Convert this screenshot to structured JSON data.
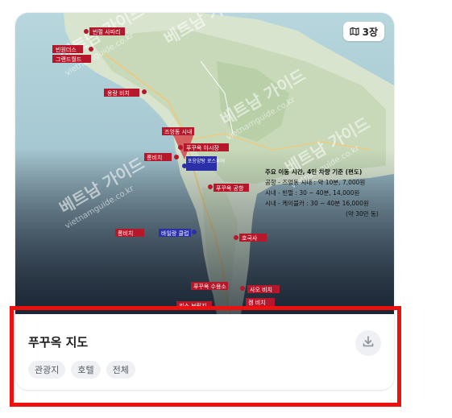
{
  "card": {
    "photo_count": "3장",
    "title": "푸꾸옥 지도",
    "tags": [
      "관광지",
      "호텔",
      "전체"
    ],
    "download_icon": "download-icon",
    "map_icon": "map-icon"
  },
  "map": {
    "watermark": [
      "베트남 가이드",
      "vietnamguide.co.kr"
    ],
    "labels": {
      "vinpearl_safari": "빈펄 사파리",
      "vinwonders": "빈원더스",
      "grand_world": "그랜드월드",
      "ong_lang_beach": "옹랑 비치",
      "duong_dong_center": "즈엉동 시내",
      "phu_quoc_night_market": "푸꾸옥 야시장",
      "long_beach": "롱비치",
      "cong_dong_cross": "포응양탕\n로스투어",
      "phu_quoc_airport": "푸꾸옥 공항",
      "long_beach_2": "롱비치",
      "bai_dai_club": "바일랑 클럽",
      "prison": "호국사",
      "phu_quoc_port": "푸꾸옥 수용소",
      "sao_beach": "사오 비치",
      "khem_beach": "켐 비치",
      "sunset_town": "키스 브릿지"
    },
    "info_box": {
      "title": "주요 이동 시간, 4인 차량 기준 (편도)",
      "lines": [
        "공항 - 즈엉동 시내 : 약 10분, 7,000원",
        "시내 - 빈펄 : 30 ~ 40분, 14,000원",
        "시내 - 케이블카 : 30 ~ 40분  16,000원",
        "(약 30만 동)"
      ]
    }
  }
}
